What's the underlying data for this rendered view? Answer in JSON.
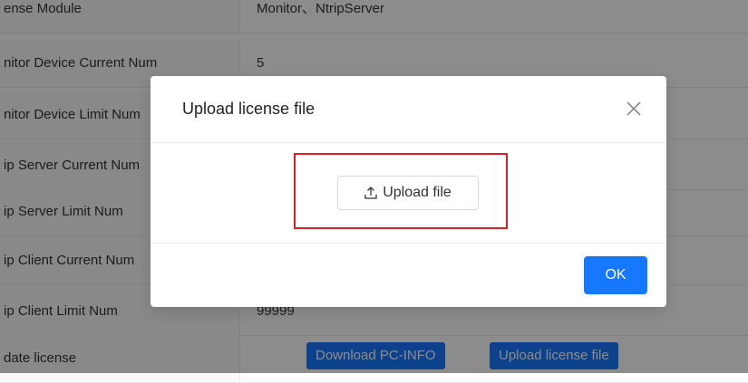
{
  "table": {
    "rows": [
      {
        "label": "ense Module",
        "value": "Monitor、NtripServer"
      },
      {
        "label": "nitor Device Current Num",
        "value": "5"
      },
      {
        "label": "nitor Device Limit Num",
        "value": ""
      },
      {
        "label": "ip Server Current Num",
        "value": ""
      },
      {
        "label": "ip Server Limit Num",
        "value": ""
      },
      {
        "label": "ip Client Current Num",
        "value": ""
      },
      {
        "label": "ip Client Limit Num",
        "value": "99999"
      },
      {
        "label": "date license",
        "value": ""
      }
    ],
    "download_pc_info_label": "Download PC-INFO",
    "upload_license_file_label": "Upload license file"
  },
  "modal": {
    "title": "Upload license file",
    "upload_button_label": "Upload file",
    "ok_label": "OK",
    "close_icon": "close-icon",
    "upload_icon": "upload-icon"
  },
  "colors": {
    "primary": "#1677ff",
    "highlight_border": "#e02020"
  }
}
